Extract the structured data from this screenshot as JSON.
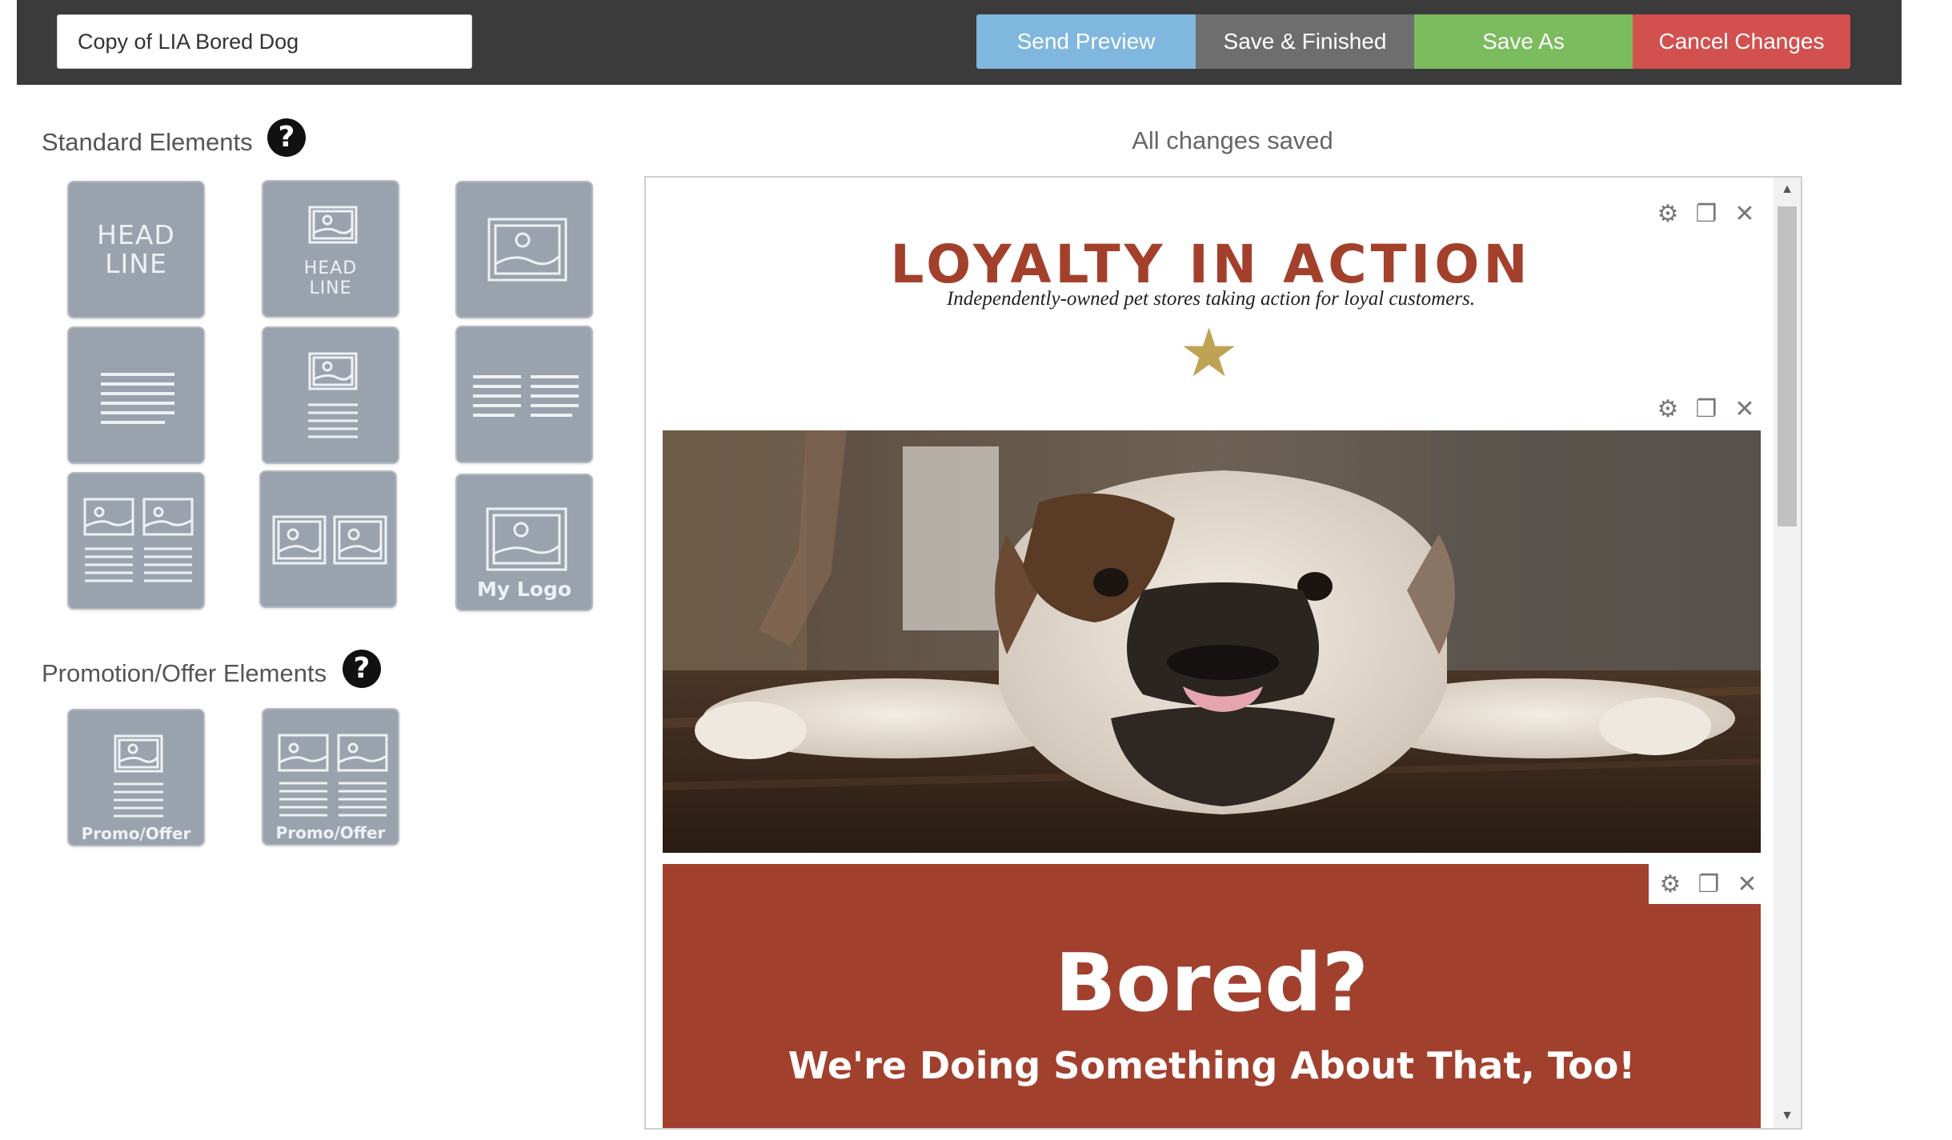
{
  "toolbar": {
    "title_value": "Copy of LIA Bored Dog",
    "send_preview": "Send Preview",
    "save_finished": "Save & Finished",
    "save_as": "Save As",
    "cancel_changes": "Cancel Changes",
    "colors": {
      "preview": "#7fb7de",
      "save": "#6e6e6e",
      "save_as": "#7bbc5e",
      "cancel": "#d2504e"
    }
  },
  "sidebar": {
    "standard_label": "Standard Elements",
    "promo_label": "Promotion/Offer Elements",
    "help_glyph": "?",
    "tiles": {
      "headline_word1": "HEAD",
      "headline_word2": "LINE",
      "my_logo": "My Logo",
      "promo_offer": "Promo/Offer"
    }
  },
  "status": {
    "text": "All changes saved"
  },
  "email": {
    "headline": "LOYALTY IN ACTION",
    "tagline": "Independently-owned pet stores taking action for loyal customers.",
    "star": "★",
    "promo_heading": "Bored?",
    "promo_subheading": "We're Doing Something About That, Too!",
    "colors": {
      "brand_red": "#a2402e",
      "star_gold": "#bfa355"
    }
  },
  "block_tool_icons": [
    "gear-icon",
    "duplicate-icon",
    "close-icon"
  ],
  "tool_glyphs": {
    "gear": "⚙",
    "duplicate": "❐",
    "close": "✕"
  }
}
